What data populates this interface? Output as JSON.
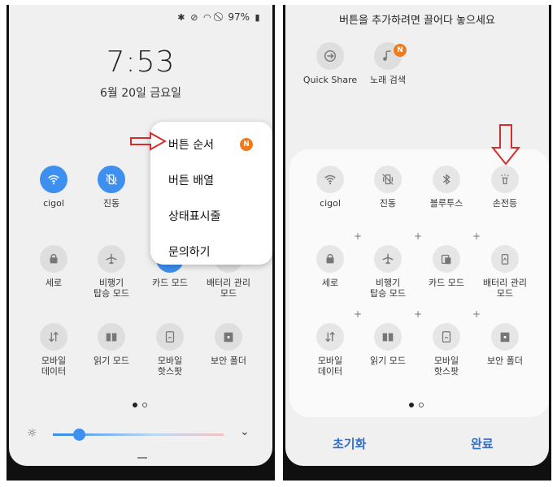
{
  "left": {
    "status": {
      "battery": "97%"
    },
    "clock": "7:53",
    "date": "6월 20일 금요일",
    "tiles": [
      {
        "label": "cigol",
        "icon": "wifi-icon",
        "active": true
      },
      {
        "label": "진동",
        "icon": "vibrate-icon",
        "active": true
      },
      {
        "label": "세로",
        "icon": "portrait-lock-icon",
        "active": false
      },
      {
        "label": "비행기\n탑승 모드",
        "icon": "airplane-icon",
        "active": false
      },
      {
        "label": "카드 모드",
        "icon": "card-icon",
        "active": true
      },
      {
        "label": "배터리 관리\n모드",
        "icon": "battery-icon",
        "active": false
      },
      {
        "label": "모바일\n데이터",
        "icon": "mobile-data-icon",
        "active": false
      },
      {
        "label": "읽기 모드",
        "icon": "book-icon",
        "active": false
      },
      {
        "label": "모바일\n핫스팟",
        "icon": "hotspot-icon",
        "active": false
      },
      {
        "label": "보안 폴더",
        "icon": "secure-folder-icon",
        "active": false
      }
    ],
    "menu": [
      {
        "label": "버튼 순서",
        "badge": "N"
      },
      {
        "label": "버튼 배열"
      },
      {
        "label": "상태표시줄"
      },
      {
        "label": "문의하기"
      }
    ],
    "brightness": 0.15
  },
  "right": {
    "hint": "버튼을 추가하려면 끌어다 놓으세요",
    "available": [
      {
        "label": "Quick Share",
        "icon": "quick-share-icon"
      },
      {
        "label": "노래 검색",
        "icon": "music-note-icon",
        "badge": "N"
      }
    ],
    "tiles": [
      {
        "label": "cigol",
        "icon": "wifi-icon"
      },
      {
        "label": "진동",
        "icon": "vibrate-icon"
      },
      {
        "label": "블루투스",
        "icon": "bluetooth-icon"
      },
      {
        "label": "손전등",
        "icon": "flashlight-icon"
      },
      {
        "label": "세로",
        "icon": "portrait-lock-icon"
      },
      {
        "label": "비행기\n탑승 모드",
        "icon": "airplane-icon"
      },
      {
        "label": "카드 모드",
        "icon": "card-icon"
      },
      {
        "label": "배터리 관리\n모드",
        "icon": "battery-icon"
      },
      {
        "label": "모바일\n데이터",
        "icon": "mobile-data-icon"
      },
      {
        "label": "읽기 모드",
        "icon": "book-icon"
      },
      {
        "label": "모바일\n핫스팟",
        "icon": "hotspot-icon"
      },
      {
        "label": "보안 폴더",
        "icon": "secure-folder-icon"
      }
    ],
    "reset": "초기화",
    "done": "완료"
  },
  "colors": {
    "accent": "#3d8ff0",
    "badge": "#f07a1e",
    "annotation": "#d32f2f",
    "button_text": "#2f6fcf"
  }
}
